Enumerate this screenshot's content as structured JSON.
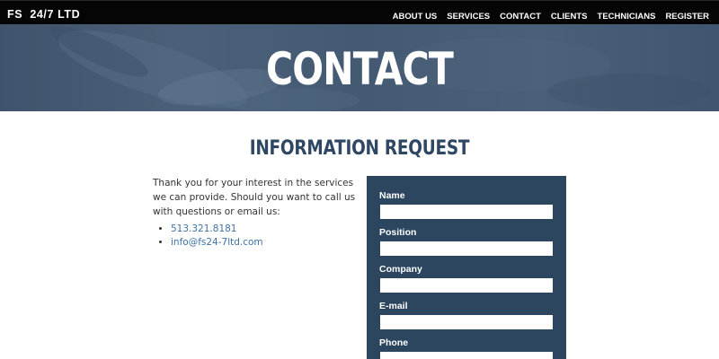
{
  "header": {
    "logo": "FS  24/7 LTD",
    "nav": [
      "ABOUT US",
      "SERVICES",
      "CONTACT",
      "CLIENTS",
      "TECHNICIANS",
      "REGISTER"
    ]
  },
  "hero": {
    "title": "CONTACT"
  },
  "main": {
    "title": "INFORMATION REQUEST",
    "intro": "Thank you for your interest in the services we can provide. Should you want to call us with questions or email us:",
    "contacts": [
      "513.321.8181",
      "info@fs24-7ltd.com"
    ]
  },
  "form": {
    "fields": [
      {
        "label": "Name",
        "value": ""
      },
      {
        "label": "Position",
        "value": ""
      },
      {
        "label": "Company",
        "value": ""
      },
      {
        "label": "E-mail",
        "value": ""
      },
      {
        "label": "Phone",
        "value": ""
      }
    ]
  },
  "colors": {
    "topbar": "#050505",
    "hero": "#4b6078",
    "title": "#2e4763",
    "form_panel": "#2c4660",
    "link": "#3e72a4"
  }
}
